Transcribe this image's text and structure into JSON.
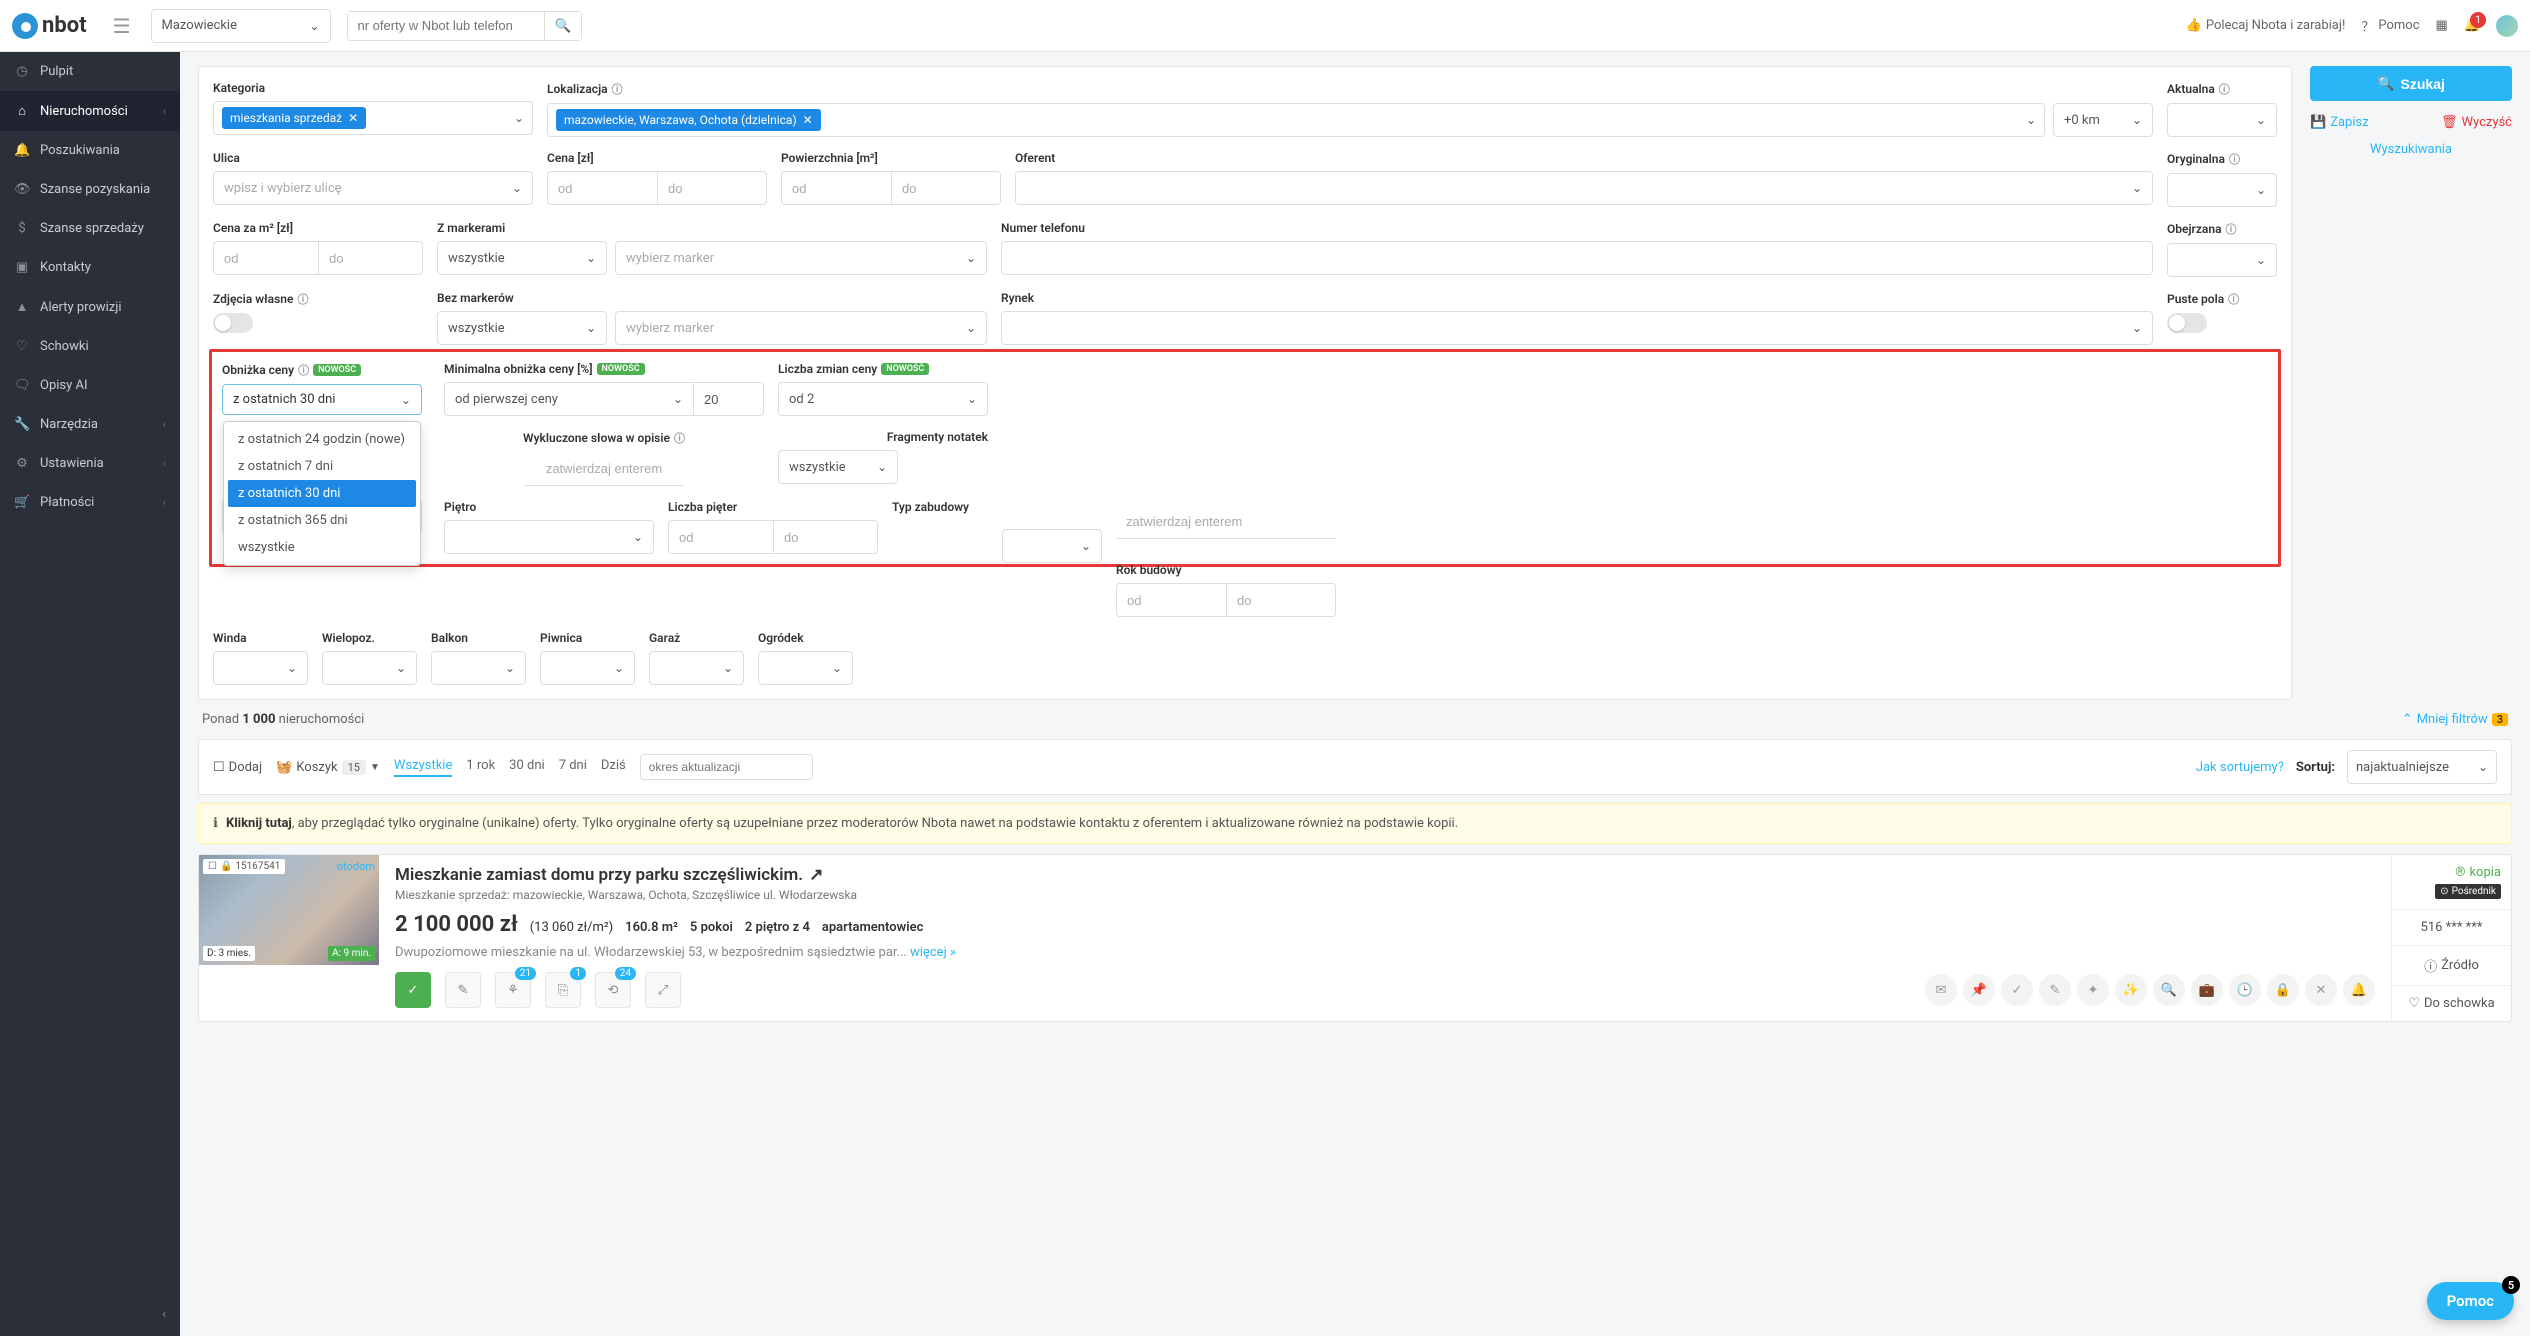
{
  "header": {
    "logo": "nbot",
    "region": "Mazowieckie",
    "offer_search_placeholder": "nr oferty w Nbot lub telefon",
    "recommend": "Polecaj Nbota i zarabiaj!",
    "help": "Pomoc",
    "notif_count": "1"
  },
  "sidebar": {
    "items": [
      {
        "label": "Pulpit",
        "icon": "◷"
      },
      {
        "label": "Nieruchomości",
        "icon": "⌂",
        "active": true,
        "chev": true
      },
      {
        "label": "Poszukiwania",
        "icon": "🔔"
      },
      {
        "label": "Szanse pozyskania",
        "icon": "👁"
      },
      {
        "label": "Szanse sprzedaży",
        "icon": "$"
      },
      {
        "label": "Kontakty",
        "icon": "▣"
      },
      {
        "label": "Alerty prowizji",
        "icon": "▲"
      },
      {
        "label": "Schowki",
        "icon": "♡"
      },
      {
        "label": "Opisy AI",
        "icon": "🗨"
      },
      {
        "label": "Narzędzia",
        "icon": "🔧",
        "chev": true
      },
      {
        "label": "Ustawienia",
        "icon": "⚙",
        "chev": true
      },
      {
        "label": "Płatności",
        "icon": "🛒",
        "chev": true
      }
    ]
  },
  "filters": {
    "kategoria_label": "Kategoria",
    "kategoria_tag": "mieszkania sprzedaż",
    "lokalizacja_label": "Lokalizacja",
    "lokalizacja_tag": "mazowieckie, Warszawa, Ochota (dzielnica)",
    "lokalizacja_km": "+0 km",
    "aktualna_label": "Aktualna",
    "ulica_label": "Ulica",
    "ulica_placeholder": "wpisz i wybierz ulicę",
    "cena_label": "Cena [zł]",
    "pow_label": "Powierzchnia [m²]",
    "oferent_label": "Oferent",
    "oryginalna_label": "Oryginalna",
    "cena_m2_label": "Cena za m² [zł]",
    "z_markerami_label": "Z markerami",
    "wszystkie": "wszystkie",
    "wybierz_marker": "wybierz marker",
    "numer_telefonu_label": "Numer telefonu",
    "obejrzana_label": "Obejrzana",
    "zdjecia_wlasne_label": "Zdjęcia własne",
    "bez_markerow_label": "Bez markerów",
    "rynek_label": "Rynek",
    "puste_pola_label": "Puste pola",
    "obnizka_label": "Obniżka ceny",
    "obnizka_val": "z ostatnich 30 dni",
    "obnizka_options": [
      "z ostatnich 24 godzin (nowe)",
      "z ostatnich 7 dni",
      "z ostatnich 30 dni",
      "z ostatnich 365 dni",
      "wszystkie"
    ],
    "min_obnizka_label": "Minimalna obniżka ceny [%]",
    "min_obnizka_sel": "od pierwszej ceny",
    "min_obnizka_val": "20",
    "liczba_zmian_label": "Liczba zmian ceny",
    "liczba_zmian_val": "od 2",
    "wykluczone_label": "Wykluczone słowa w opisie",
    "zatwierdzaj_placeholder": "zatwierdzaj enterem",
    "fragmenty_label": "Fragmenty notatek",
    "pietro_label": "Piętro",
    "liczba_pieter_label": "Liczba pięter",
    "typ_zabudowy_label": "Typ zabudowy",
    "rok_budowy_label": "Rok budowy",
    "winda_label": "Winda",
    "wielopoz_label": "Wielopoz.",
    "balkon_label": "Balkon",
    "piwnica_label": "Piwnica",
    "garaz_label": "Garaż",
    "ogrodek_label": "Ogródek",
    "od": "od",
    "do": "do"
  },
  "actions": {
    "search": "Szukaj",
    "save": "Zapisz",
    "clear": "Wyczyść",
    "searches": "Wyszukiwania"
  },
  "results": {
    "count_prefix": "Ponad ",
    "count_num": "1 000",
    "count_suffix": " nieruchomości",
    "fewer": "Mniej filtrów",
    "fewer_badge": "3"
  },
  "toolbar": {
    "add": "Dodaj",
    "basket": "Koszyk",
    "basket_count": "15",
    "tabs": [
      "Wszystkie",
      "1 rok",
      "30 dni",
      "7 dni",
      "Dziś"
    ],
    "sort_placeholder": "okres aktualizacji",
    "how_sort": "Jak sortujemy?",
    "sort_label": "Sortuj:",
    "sort_val": "najaktualniejsze"
  },
  "banner": {
    "bold": "Kliknij tutaj",
    "text": ", aby przeglądać tylko oryginalne (unikalne) oferty. Tylko oryginalne oferty są uzupełniane przez moderatorów Nbota nawet na podstawie kontaktu z oferentem i aktualizowane również na podstawie kopii."
  },
  "listing": {
    "id": "15167541",
    "source": "otodom",
    "d_time": "D: 3 mies.",
    "a_time": "A: 9 min.",
    "title": "Mieszkanie zamiast domu przy parku szczęśliwickim.",
    "subtitle": "Mieszkanie sprzedaż: mazowieckie, Warszawa, Ochota, Szczęśliwice ul. Włodarzewska",
    "price": "2 100 000 zł",
    "price_m2": "(13 060 zł/m²)",
    "area": "160.8 m²",
    "rooms": "5 pokoi",
    "floor": "2 piętro z 4",
    "type": "apartamentowiec",
    "desc": "Dwupoziomowe mieszkanie na ul. Włodarzewskiej 53, w bezpośrednim sąsiedztwie par...",
    "more": "więcej",
    "chip_badges": [
      "21",
      "1",
      "24"
    ],
    "kopia": "kopia",
    "posrednik": "Pośrednik",
    "phone": "516 *** ***",
    "zrodlo": "Źródło",
    "schowek": "Do schowka"
  },
  "help": {
    "label": "Pomoc",
    "badge": "5"
  }
}
